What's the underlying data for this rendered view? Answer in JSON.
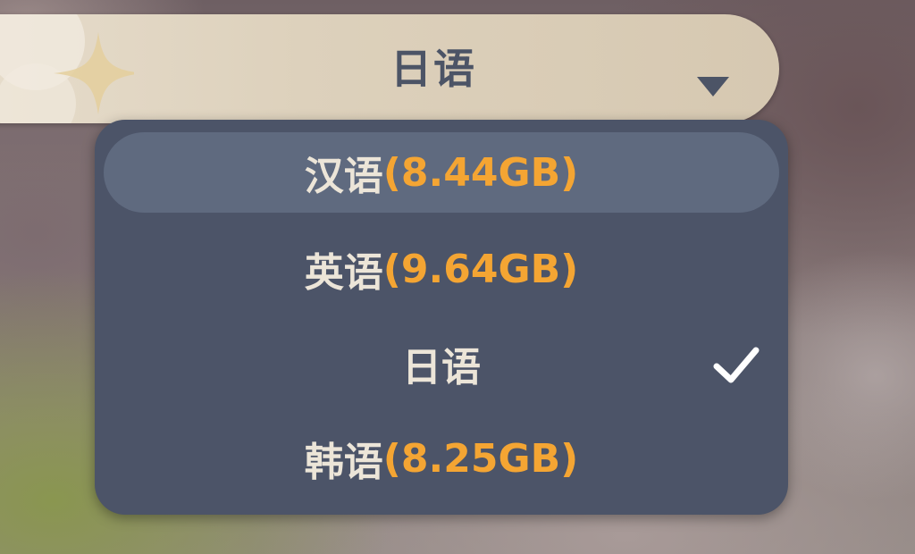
{
  "selector": {
    "current_value": "日语",
    "arrow_icon": "caret-down-icon"
  },
  "options": [
    {
      "label": "汉语",
      "size": "(8.44GB)",
      "highlighted": true,
      "selected": false
    },
    {
      "label": "英语",
      "size": "(9.64GB)",
      "highlighted": false,
      "selected": false
    },
    {
      "label": "日语",
      "size": "",
      "highlighted": false,
      "selected": true
    },
    {
      "label": "韩语",
      "size": "(8.25GB)",
      "highlighted": false,
      "selected": false
    }
  ],
  "colors": {
    "header_bg": "#ddd1bc",
    "header_text": "#4c5466",
    "panel_bg": "#4c5468",
    "highlight_bg": "#5f6a7f",
    "option_text": "#ece5d8",
    "size_text": "#f4a533"
  },
  "icons": {
    "selected_marker": "checkmark-icon",
    "header_decoration": "sparkle-icon"
  }
}
